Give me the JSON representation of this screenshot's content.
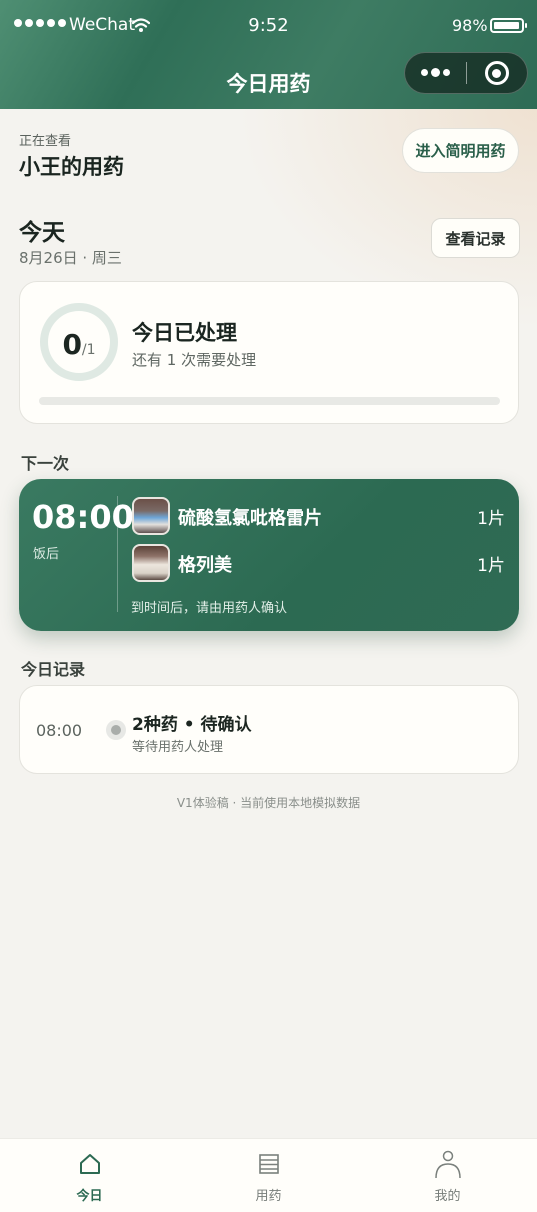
{
  "status_bar": {
    "carrier": "WeChat",
    "time": "9:52",
    "battery": "98%",
    "battery_level": 0.98
  },
  "nav": {
    "title": "今日用药",
    "more_icon": "more-dots-icon",
    "close_icon": "miniprogram-close-icon"
  },
  "viewing": {
    "label": "正在查看",
    "name": "小王的用药",
    "simple_mode_button": "进入简明用药"
  },
  "today": {
    "title": "今天",
    "date": "8月26日 · 周三",
    "records_button": "查看记录"
  },
  "progress": {
    "done": "0",
    "total": "/1",
    "title": "今日已处理",
    "subtitle": "还有 1 次需要处理",
    "fraction": 0
  },
  "next": {
    "section_label": "下一次",
    "time": "08:00",
    "meal": "饭后",
    "meds": [
      {
        "name": "硫酸氢氯吡格雷片",
        "qty": "1片"
      },
      {
        "name": "格列美",
        "qty": "1片"
      }
    ],
    "note": "到时间后，请由用药人确认"
  },
  "records": {
    "section_label": "今日记录",
    "items": [
      {
        "time": "08:00",
        "title": "2种药 • 待确认",
        "subtitle": "等待用药人处理"
      }
    ]
  },
  "footnote": "V1体验稿 · 当前使用本地模拟数据",
  "tabbar": {
    "tabs": [
      {
        "label": "今日",
        "icon": "home-icon",
        "active": true
      },
      {
        "label": "用药",
        "icon": "list-icon",
        "active": false
      },
      {
        "label": "我的",
        "icon": "user-icon",
        "active": false
      }
    ]
  },
  "colors": {
    "brand": "#2f6f57",
    "background": "#f4f3ef"
  }
}
